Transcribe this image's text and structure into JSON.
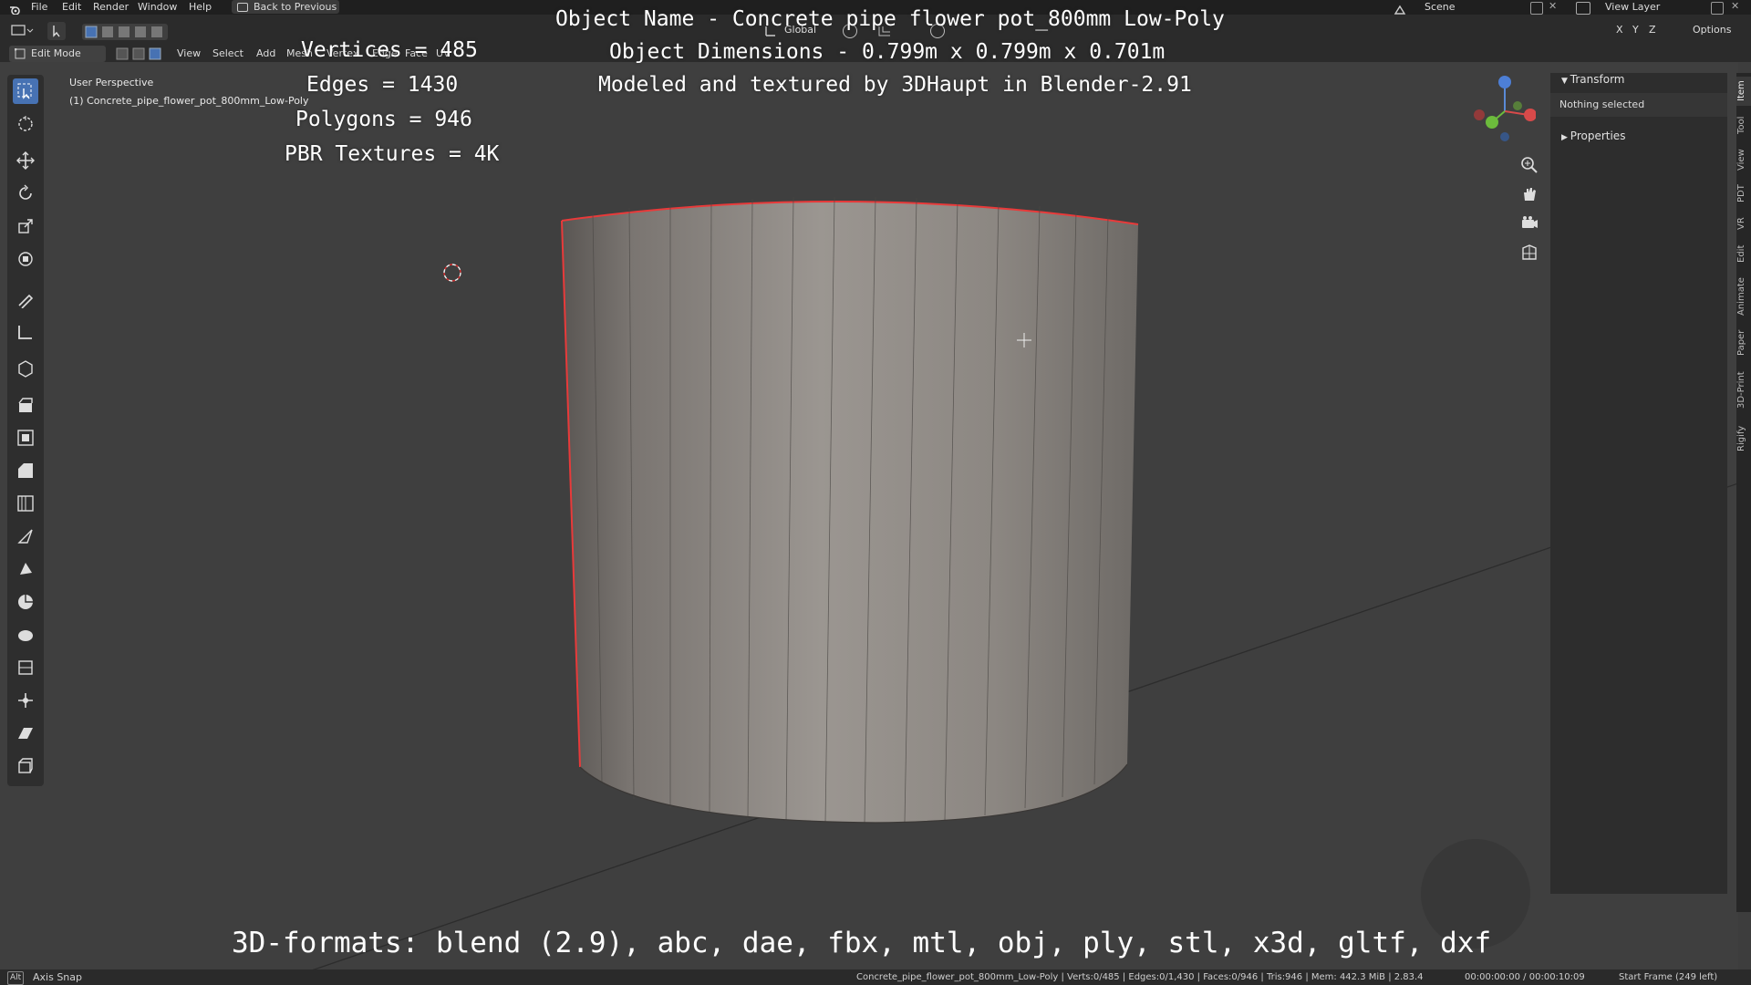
{
  "topmenu": {
    "items": [
      "File",
      "Edit",
      "Render",
      "Window",
      "Help"
    ],
    "back_label": "Back to Previous",
    "scene_label": "Scene",
    "view_layer_label": "View Layer"
  },
  "header": {
    "mode_label": "Edit Mode",
    "menus": [
      "View",
      "Select",
      "Add",
      "Mesh",
      "Vertex",
      "Edge",
      "Face",
      "UV"
    ],
    "transform_orientation": "Global",
    "options_label": "Options",
    "axis_labels": [
      "X",
      "Y",
      "Z"
    ]
  },
  "viewport": {
    "perspective_label": "User Perspective",
    "object_label": "(1) Concrete_pipe_flower_pot_800mm_Low-Poly",
    "overlay_lines": [
      "Object Name - Concrete pipe flower pot_800mm Low-Poly",
      "Object Dimensions -  0.799m x 0.799m x 0.701m",
      "Modeled and textured by 3DHaupt in Blender-2.91"
    ],
    "stats": [
      "Vertices = 485",
      "Edges = 1430",
      "Polygons = 946",
      "PBR Textures = 4K"
    ],
    "formats_line": "3D-formats: blend (2.9), abc, dae, fbx, mtl, obj, ply, stl, x3d, gltf, dxf"
  },
  "npanel": {
    "transform_label": "Transform",
    "nothing_selected": "Nothing selected",
    "properties_label": "Properties",
    "tabs": [
      "Item",
      "Tool",
      "View",
      "PDT",
      "VR",
      "Edit",
      "Animate",
      "Paper",
      "3D-Print",
      "Rigify"
    ]
  },
  "statusbar": {
    "left_key": "Alt",
    "left_label": "Axis Snap",
    "center": "Concrete_pipe_flower_pot_800mm_Low-Poly | Verts:0/485 | Edges:0/1,430 | Faces:0/946 | Tris:946 | Mem: 442.3 MiB | 2.83.4",
    "time": "00:00:00:00 / 00:00:10:09",
    "frame": "Start Frame (249 left)"
  },
  "colors": {
    "accent": "#4772b3",
    "selection_edge": "#e83a3a",
    "concrete": "#8f8a85"
  }
}
